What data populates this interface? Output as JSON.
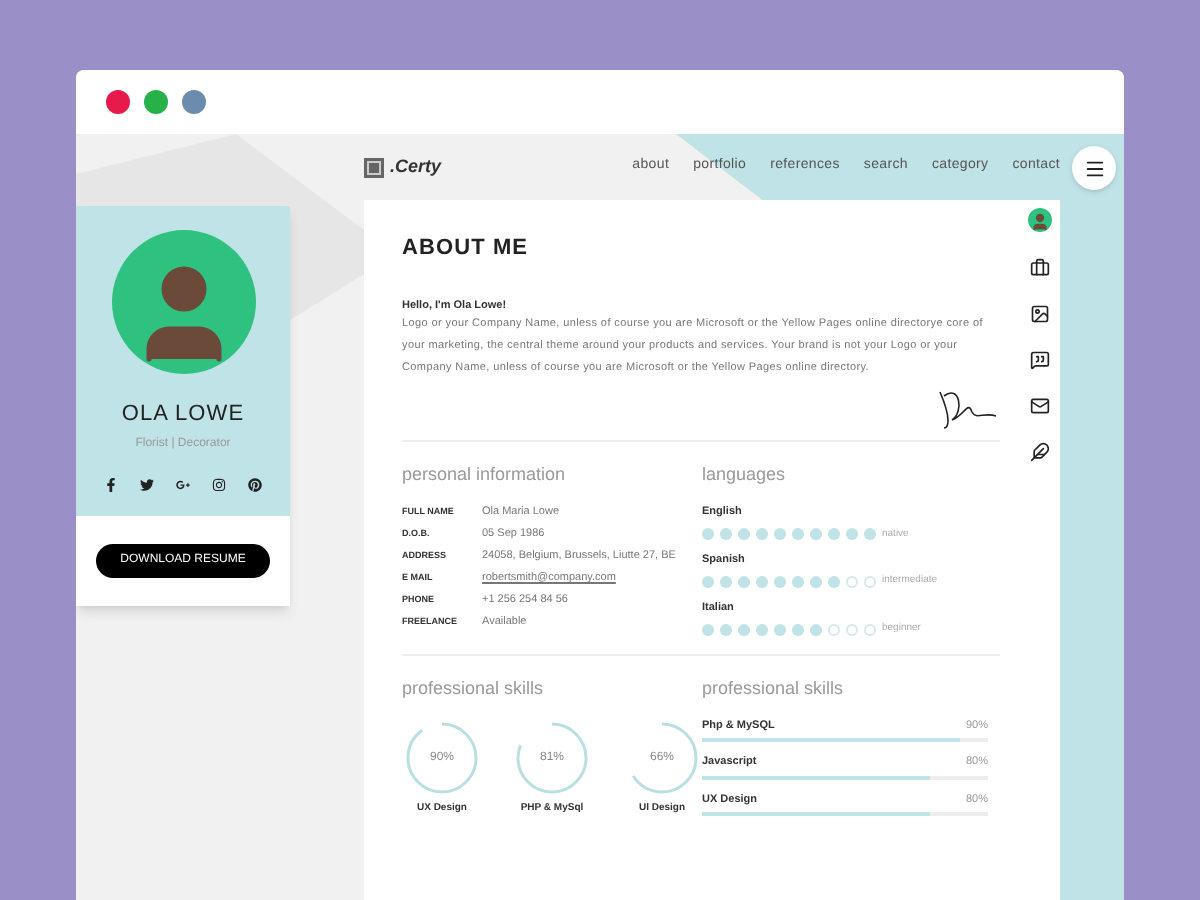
{
  "browser": {
    "dots": [
      {
        "color": "#e8194b"
      },
      {
        "color": "#27b14a"
      },
      {
        "color": "#6c8cad"
      }
    ]
  },
  "brand": {
    "name": ".Certy"
  },
  "nav": [
    {
      "label": "about"
    },
    {
      "label": "portfolio"
    },
    {
      "label": "references"
    },
    {
      "label": "search"
    },
    {
      "label": "category"
    },
    {
      "label": "contact"
    }
  ],
  "profile": {
    "name": "OLA LOWE",
    "role": "Florist | Decorator",
    "button": "DOWNLOAD RESUME"
  },
  "about": {
    "title": "ABOUT ME",
    "greeting": "Hello, I'm Ola Lowe!",
    "text": "Logo or your Company Name, unless of course you are Microsoft or the Yellow Pages online directorye core of your marketing, the central theme around your products and services. Your brand is not your Logo or your Company Name, unless of course you are Microsoft or the Yellow Pages online directory."
  },
  "personal": {
    "title": "personal information",
    "rows": [
      {
        "label": "FULL NAME",
        "value": "Ola Maria Lowe",
        "kind": "text"
      },
      {
        "label": "D.O.B.",
        "value": "05 Sep 1986",
        "kind": "text"
      },
      {
        "label": "ADDRESS",
        "value": "24058, Belgium, Brussels, Liutte 27, BE",
        "kind": "text"
      },
      {
        "label": "E MAIL",
        "value": "robertsmith@company.com",
        "kind": "link"
      },
      {
        "label": "PHONE",
        "value": "+1 256 254 84 56",
        "kind": "text"
      },
      {
        "label": "FREELANCE",
        "value": "Available",
        "kind": "text"
      }
    ]
  },
  "languages": {
    "title": "languages",
    "items": [
      {
        "name": "English",
        "stars": 10,
        "reading": "native"
      },
      {
        "name": "Spanish",
        "stars": 8,
        "reading": "intermediate"
      },
      {
        "name": "Italian",
        "stars": 7,
        "reading": "beginner"
      }
    ]
  },
  "skills_circles": {
    "title": "professional skills",
    "items": [
      {
        "value": "90%",
        "label": "UX Design",
        "level": 0.9
      },
      {
        "value": "81%",
        "label": "PHP & MySql",
        "level": 0.81
      },
      {
        "value": "66%",
        "label": "UI Design",
        "level": 0.66
      }
    ]
  },
  "skills_bars": {
    "title": "professional skills",
    "items": [
      {
        "name": "Php & MySQL",
        "value": "90%",
        "level": 0.9
      },
      {
        "name": "Javascript",
        "value": "80%",
        "level": 0.8
      },
      {
        "name": "UX Design",
        "value": "80%",
        "level": 0.8
      }
    ]
  }
}
